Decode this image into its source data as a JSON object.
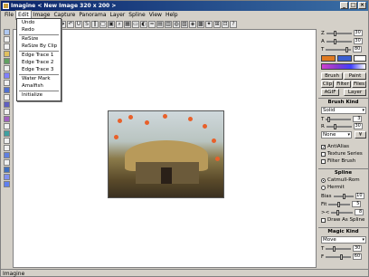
{
  "window": {
    "title": "Imagine < New Image 320 x 200 >"
  },
  "menu": [
    "File",
    "Edit",
    "Image",
    "Capture",
    "Panorama",
    "Layer",
    "Spline",
    "View",
    "Help"
  ],
  "edit_menu": {
    "items": [
      "Undo",
      "Redo",
      "ReSize",
      "ReSize By Clip",
      "Edge Trace 1",
      "Edge Trace 2",
      "Edge Trace 3",
      "Water Mark",
      "Amalfish",
      "Initialize"
    ]
  },
  "status": {
    "text": "Imagine"
  },
  "panel": {
    "z": {
      "label": "Z",
      "value": "30"
    },
    "a": {
      "label": "A",
      "value": "30"
    },
    "t": {
      "label": "T",
      "value": "80"
    },
    "buttons": [
      "Brush",
      "Paint",
      "Clip",
      "Filter",
      "Files",
      "AGIF",
      "Layer"
    ],
    "brush_kind": {
      "title": "Brush Kind",
      "selected": "Solid",
      "t_value": "3",
      "r_value": "30",
      "mode": "None",
      "mode_btn": "¥"
    },
    "checks": [
      {
        "label": "AntiAlias",
        "checked": true
      },
      {
        "label": "Texture Series",
        "checked": false
      },
      {
        "label": "Filter Brush",
        "checked": false
      }
    ],
    "spline": {
      "title": "Spline",
      "radios": [
        {
          "label": "Catmull-Rom",
          "on": true
        },
        {
          "label": "Hermit",
          "on": false
        }
      ],
      "rows": [
        {
          "label": "Bias",
          "value": "10"
        },
        {
          "label": "Fit",
          "value": "5"
        },
        {
          "label": "><",
          "value": "8"
        }
      ],
      "draw_label": "Draw As Spline"
    },
    "magic": {
      "title": "Magic Kind",
      "selected": "Move",
      "t_value": "30",
      "f_value": "60"
    }
  },
  "colors": {
    "fg": "#3a5fd0",
    "bg": "#ffffff",
    "accent1": "#e07a20",
    "accent2": "#8a3ad0"
  }
}
